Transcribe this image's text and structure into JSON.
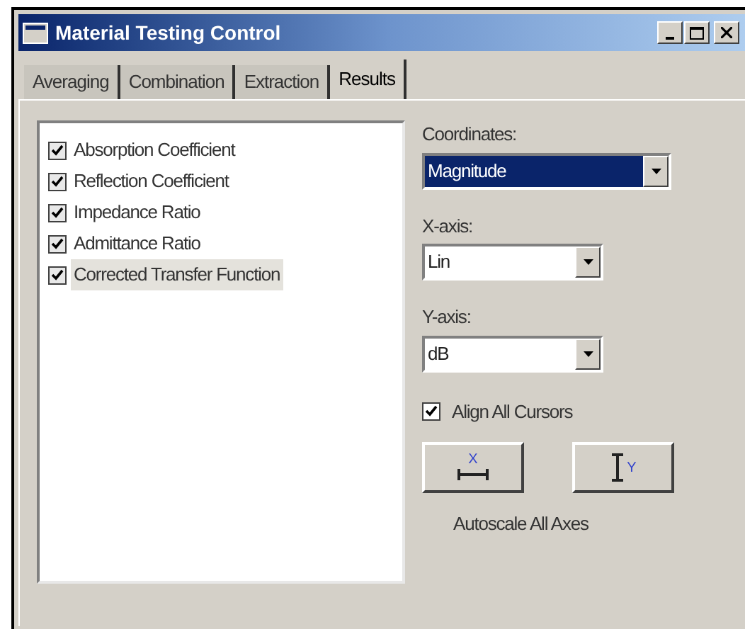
{
  "window": {
    "title": "Material Testing Control"
  },
  "tabs": [
    {
      "label": "Averaging",
      "selected": false
    },
    {
      "label": "Combination",
      "selected": false
    },
    {
      "label": "Extraction",
      "selected": false
    },
    {
      "label": "Results",
      "selected": true
    }
  ],
  "results_list": [
    {
      "label": "Absorption Coefficient",
      "checked": true,
      "selected": false
    },
    {
      "label": "Reflection Coefficient",
      "checked": true,
      "selected": false
    },
    {
      "label": "Impedance Ratio",
      "checked": true,
      "selected": false
    },
    {
      "label": "Admittance Ratio",
      "checked": true,
      "selected": false
    },
    {
      "label": "Corrected Transfer Function",
      "checked": true,
      "selected": true
    }
  ],
  "dropdowns": [
    {
      "label": "Coordinates:",
      "value": "Magnitude",
      "focused": true
    },
    {
      "label": "X-axis:",
      "value": "Lin",
      "focused": false
    },
    {
      "label": "Y-axis:",
      "value": "dB",
      "focused": false
    }
  ],
  "align_cursors": {
    "label": "Align All Cursors",
    "checked": true
  },
  "autoscale_buttons": [
    {
      "kind": "x",
      "letter": "X"
    },
    {
      "kind": "y",
      "letter": "Y"
    }
  ],
  "autoscale_label": "Autoscale All Axes"
}
